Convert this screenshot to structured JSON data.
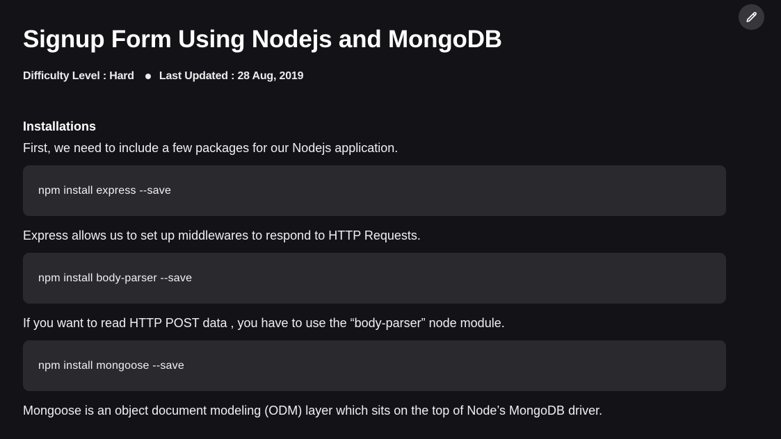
{
  "article": {
    "title": "Signup Form Using Nodejs and MongoDB",
    "meta": {
      "difficulty": "Difficulty Level : Hard",
      "last_updated": "Last Updated : 28 Aug, 2019"
    },
    "section_heading": "Installations",
    "paragraphs": [
      "First, we need to include a few packages for our Nodejs application.",
      "Express allows us to set up middlewares to respond to HTTP Requests.",
      "If you want to read HTTP POST data , you have to use the “body-parser” node module.",
      "Mongoose is an object document modeling (ODM) layer which sits on the top of Node’s MongoDB driver."
    ],
    "code_blocks": [
      "npm install express --save",
      "npm install body-parser --save",
      "npm install mongoose --save"
    ]
  },
  "toolbar": {
    "edit_icon": "pencil-icon"
  },
  "colors": {
    "background": "#131317",
    "code_background": "#29292e",
    "edit_button_background": "#36363b"
  }
}
